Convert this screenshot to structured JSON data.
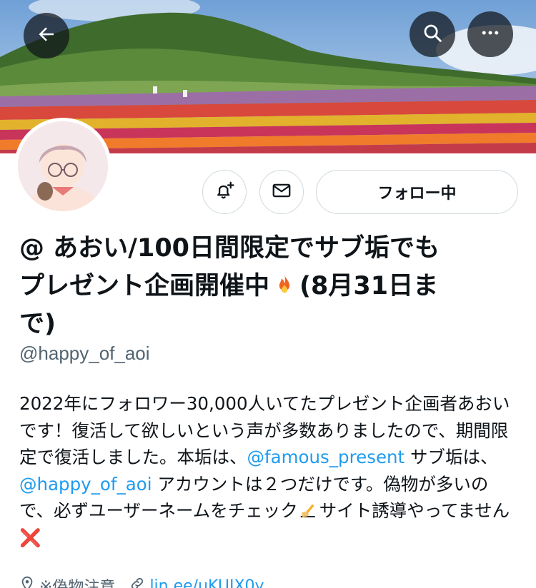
{
  "header": {
    "back_icon": "arrow-left-icon",
    "search_icon": "search-icon",
    "more_icon": "more-horizontal-icon"
  },
  "actions": {
    "notify_icon": "bell-plus-icon",
    "message_icon": "envelope-icon",
    "follow_label": "フォロー中"
  },
  "profile": {
    "name_line1": "@ あおい/100日間限定でサブ垢でも",
    "name_line2": "プレゼント企画開催中",
    "name_line2b": "(8月31日ま",
    "name_line3": "で)",
    "handle": "@happy_of_aoi"
  },
  "bio": {
    "text1": "2022年にフォロワー30,000人いてたプレゼント企画者あおいです！復活して欲しいという声が多数ありましたので、期間限定で復活しました。本垢は、",
    "mention1": "@famous_present",
    "text2": " サブ垢は、",
    "mention2": "@happy_of_aoi",
    "text3": " アカウントは２つだけです。偽物が多いので、必ずユーザーネームをチェック",
    "text4": "サイト誘導やってません",
    "x_mark": "❌"
  },
  "meta": {
    "location": "※偽物注意",
    "link": "lin.ee/uKUIX0y"
  },
  "colors": {
    "accent": "#1d9bf0",
    "text": "#0f1419",
    "secondary": "#536471",
    "border": "#cfd9de"
  }
}
